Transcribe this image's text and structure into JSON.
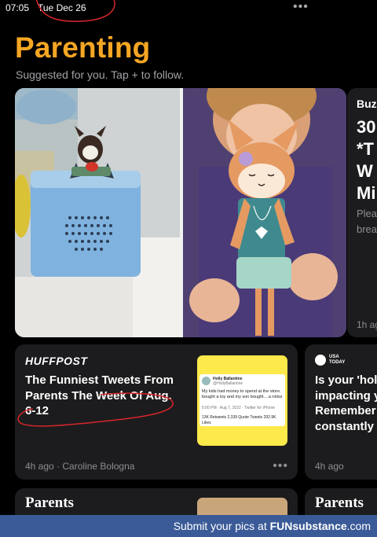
{
  "status_bar": {
    "time": "07:05",
    "date": "Tue Dec 26",
    "more": "•••"
  },
  "header": {
    "title": "Parenting",
    "subtitle": "Suggested for you. Tap + to follow."
  },
  "colors": {
    "accent": "#f5a623",
    "background": "#000000",
    "card": "#1c1c1e",
    "meta_text": "#8e8e93",
    "annotation_red": "#d6262b",
    "footer_bar": "#3b5b98"
  },
  "hero": {
    "left_image_label": "toy-speaker-photo",
    "right_image_label": "fox-doll-photo"
  },
  "side_card": {
    "source": "Buz",
    "headline": "30\n*T\nW\nMi",
    "snippet": "Plea\nbrea",
    "time": "1h ag"
  },
  "cards": [
    {
      "source": "HUFFPOST",
      "headline": "The Funniest Tweets From Parents The Week Of Aug. 6-12",
      "time": "4h ago",
      "author": "Caroline Bologna",
      "more": "•••",
      "thumbnail": {
        "tweet_name": "Holly Ballantine",
        "tweet_handle": "@HollyBallantine",
        "tweet_text": "My kids had money to spend at the store. bought a toy and my son bought....a rotiss",
        "tweet_date": "5:00 PM · Aug 7, 2022 · Twitter for iPhone",
        "tweet_stats": "13K Retweets   2,339 Quote Tweets   292.9K Likes"
      }
    },
    {
      "source_line1": "USA",
      "source_line2": "TODAY",
      "headline": "Is your 'holi\nimpacting y\nRemember\nconstantly",
      "time": "4h ago"
    }
  ],
  "bottom_cards": [
    {
      "source": "Parents"
    },
    {
      "source": "Parents"
    }
  ],
  "footer": {
    "prefix": "Submit your pics at ",
    "brand": "FUNsubstance",
    "suffix": ".com"
  }
}
